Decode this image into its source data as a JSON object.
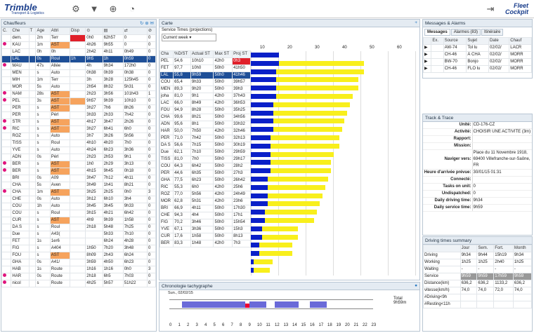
{
  "app": {
    "logo": "Trimble",
    "logo_sub": "Transport & Logistics",
    "fleet1": "Fleet",
    "fleet2": "Cockpit"
  },
  "drivers": {
    "title": "Chauffeurs",
    "cols": [
      "C.",
      "Che",
      "T",
      "Age",
      "Attri",
      "Disp",
      "⊙",
      "▤",
      "⇄",
      "⊘"
    ],
    "rows": [
      [
        "",
        "dem.",
        "",
        "2m",
        "Terr",
        "",
        "0h0",
        "62h57",
        "0",
        "0"
      ],
      [
        "•",
        "KAU",
        "",
        "1m",
        "AST",
        "",
        "4h26",
        "9h55",
        "0",
        "0"
      ],
      [
        "",
        "LAC",
        "",
        "0h",
        "0h",
        "",
        "2h42",
        "4h11",
        "0h49",
        "0"
      ],
      [
        "",
        "LAL",
        "",
        "0s",
        "Roul",
        "1h",
        "9h5",
        "1h",
        "0h59",
        "0"
      ],
      [
        "•",
        "MAU",
        "",
        "47s",
        "Allée",
        "",
        "4h",
        "9h34",
        "172h0",
        "0"
      ],
      [
        "",
        "MEN",
        "",
        "s",
        "Auto",
        "",
        "0h38",
        "0h39",
        "0h38",
        "0"
      ],
      [
        "",
        "MIH",
        "",
        "1m",
        "Terr",
        "",
        "3h",
        "3h28",
        "125h45",
        "0"
      ],
      [
        "",
        "MOR",
        "",
        "5s",
        "Auto",
        "",
        "2h54",
        "8h32",
        "5h31",
        "0"
      ],
      [
        "•",
        "NAM",
        "",
        "28s",
        "AST",
        "",
        "2h23",
        "3h56",
        "101h43",
        "1"
      ],
      [
        "•",
        "PEL",
        "",
        "3s",
        "AST",
        "",
        "9h57",
        "9h39",
        "10h10",
        "0"
      ],
      [
        "",
        "PER",
        "",
        "s",
        "AST",
        "",
        "3h27",
        "7h6",
        "8h26",
        "0"
      ],
      [
        "",
        "PER",
        "",
        "s",
        "Pérl",
        "",
        "3h33",
        "2h33",
        "7h42",
        "0"
      ],
      [
        "•",
        "STR",
        "",
        "s",
        "AST",
        "",
        "4h17",
        "3h47",
        "2h26",
        "0"
      ],
      [
        "•",
        "RIC",
        "",
        "s",
        "AST",
        "",
        "3h27",
        "6h41",
        "6h0",
        "0"
      ],
      [
        "",
        "ROZ",
        "",
        "s",
        "Auto",
        "",
        "3h7",
        "3h26",
        "5h56",
        "0"
      ],
      [
        "",
        "TISS",
        "",
        "s",
        "Roul",
        "",
        "4h10",
        "4h20",
        "7h0",
        "0"
      ],
      [
        "",
        "YVE",
        "",
        "s",
        "Auto",
        "",
        "4h24",
        "6h23",
        "3h36",
        "0"
      ],
      [
        "",
        "ADN",
        "",
        "0s",
        "Pérl",
        "",
        "2h23",
        "2h53",
        "9h1",
        "0"
      ],
      [
        "•",
        "BER",
        "",
        "s",
        "AST",
        "",
        "1h0",
        "2h29",
        "3h13",
        "0"
      ],
      [
        "•",
        "BER",
        "",
        "s",
        "AST",
        "",
        "4h15",
        "9h45",
        "0h18",
        "0"
      ],
      [
        "",
        "BRI",
        "",
        "0s",
        "A09",
        "",
        "3h47",
        "7h12",
        "4h11",
        "0"
      ],
      [
        "",
        "CHA",
        "",
        "5s",
        "Aven",
        "",
        "3h49",
        "1h41",
        "8h21",
        "0"
      ],
      [
        "•",
        "CHA",
        "",
        "1m",
        "AST",
        "",
        "3h25",
        "2h25",
        "0h0",
        "3"
      ],
      [
        "",
        "CHE",
        "",
        "0s",
        "Auto",
        "",
        "3h12",
        "6h10",
        "3h4",
        "0"
      ],
      [
        "",
        "COU",
        "",
        "1h",
        "Auto",
        "",
        "3h45",
        "3h45",
        "9h33",
        "0"
      ],
      [
        "",
        "COU",
        "",
        "s",
        "Roul",
        "",
        "3h15",
        "4h21",
        "6h42",
        "0"
      ],
      [
        "",
        "CUR",
        "",
        "s",
        "AST",
        "",
        "4h9",
        "9h39",
        "1h58",
        "0"
      ],
      [
        "",
        "DA S",
        "",
        "s",
        "Roul",
        "",
        "2h18",
        "5h48",
        "7h25",
        "0"
      ],
      [
        "",
        "Due",
        "",
        "s",
        "A43(",
        "",
        "",
        "5h33",
        "7h10",
        "0"
      ],
      [
        "",
        "FET",
        "",
        "1s",
        "1er6",
        "",
        "",
        "6h24",
        "4h28",
        "0"
      ],
      [
        "",
        "FIG",
        "",
        "s",
        "A404",
        "",
        "1h50",
        "7h20",
        "3h48",
        "0"
      ],
      [
        "",
        "FOU",
        "",
        "s",
        "AST",
        "",
        "8h09",
        "2h43",
        "6h24",
        "0"
      ],
      [
        "",
        "GHA",
        "",
        "0s",
        "A41/",
        "",
        "3h59",
        "4h50",
        "6h23",
        "0"
      ],
      [
        "",
        "HAB",
        "",
        "1s",
        "Route",
        "",
        "1h16",
        "1h16",
        "0h0",
        "3"
      ],
      [
        "•",
        "HAR",
        "",
        "0s",
        "Route",
        "",
        "2h18",
        "6h5",
        "7h03",
        "0"
      ],
      [
        "•",
        "nicol",
        "",
        "s",
        "Route",
        "",
        "4h25",
        "5h57",
        "51h22",
        "0"
      ]
    ]
  },
  "service": {
    "title": "Carte",
    "sub": "Service Times (projections)",
    "filter": "Current week",
    "cols": [
      "Cha",
      "%D/ST",
      "Actual ST",
      "Max ST",
      "Proj ST"
    ],
    "axis": [
      "10",
      "20",
      "30",
      "40",
      "50",
      "60"
    ],
    "rows": [
      [
        "PEL",
        "54,6",
        "10h10",
        "42h0",
        "0h3",
        22,
        6
      ],
      [
        "FET",
        "97,7",
        "10h0",
        "50h0",
        "41h50",
        22,
        0
      ],
      [
        "LAL",
        "55,8",
        "9h59",
        "50h0",
        "41h46",
        22,
        0
      ],
      [
        "COU",
        "65,4",
        "9h33",
        "50h0",
        "39h57",
        20,
        0
      ],
      [
        "MEN",
        "89,3",
        "9h20",
        "50h0",
        "39h3",
        18,
        0
      ],
      [
        "joha",
        "81,0",
        "9h1",
        "42h0",
        "37h43",
        17,
        0
      ],
      [
        "LAC",
        "66,0",
        "8h49",
        "42h0",
        "36h53",
        16,
        0
      ],
      [
        "FOU",
        "94,9",
        "8h28",
        "50h0",
        "35h25",
        14,
        0
      ],
      [
        "CHA",
        "99,6",
        "8h21",
        "50h0",
        "34h56",
        13,
        0
      ],
      [
        "ADN",
        "95,6",
        "8h1",
        "50h0",
        "33h32",
        12,
        0
      ],
      [
        "HAR",
        "50,0",
        "7h50",
        "42h0",
        "32h46",
        11,
        0
      ],
      [
        "PER",
        "71,0",
        "7h42",
        "50h0",
        "32h13",
        10,
        0
      ],
      [
        "DA S",
        "56,6",
        "7h15",
        "50h0",
        "30h19",
        9,
        0
      ],
      [
        "Due",
        "62,1",
        "7h10",
        "50h0",
        "29h59",
        8,
        0
      ],
      [
        "TISS",
        "81,0",
        "7h0",
        "50h0",
        "29h17",
        7,
        0
      ],
      [
        "COU",
        "64,3",
        "6h42",
        "50h0",
        "28h2",
        6,
        0
      ],
      [
        "PER",
        "44,6",
        "6h35",
        "50h0",
        "27h3",
        5,
        0
      ],
      [
        "GHA",
        "77,5",
        "6h23",
        "50h0",
        "26h42",
        4,
        0
      ],
      [
        "RIC",
        "55,3",
        "6h0",
        "42h0",
        "25h6",
        3,
        0
      ],
      [
        "ROZ",
        "77,0",
        "5h56",
        "42h0",
        "24h49",
        3,
        0
      ],
      [
        "MOR",
        "62,8",
        "5h31",
        "42h0",
        "23h6",
        3,
        0
      ],
      [
        "BRI",
        "66,9",
        "4h11",
        "50h0",
        "17h30",
        2,
        0
      ],
      [
        "CHE",
        "94,3",
        "4h4",
        "50h0",
        "17h1",
        2,
        0
      ],
      [
        "FIG",
        "70,2",
        "3h46",
        "50h0",
        "15h54",
        1,
        0
      ],
      [
        "YVE",
        "67,1",
        "3h36",
        "50h0",
        "15h3",
        1,
        0
      ],
      [
        "CUR",
        "17,6",
        "1h58",
        "50h0",
        "8h13",
        0,
        0
      ],
      [
        "BER",
        "83,3",
        "1h48",
        "42h0",
        "7h3",
        0,
        0
      ]
    ]
  },
  "chrono": {
    "title": "Chronologie tachygraphe",
    "date": "Sun., 02/02/15",
    "total_label": "Total",
    "total": "9h59m",
    "hours": [
      "0",
      "1",
      "2",
      "3",
      "4",
      "5",
      "6",
      "7",
      "8",
      "9",
      "10",
      "11",
      "12",
      "13",
      "14",
      "15",
      "16",
      "17",
      "18",
      "19",
      "20",
      "21",
      "22",
      "23"
    ]
  },
  "messages": {
    "title": "Messages & Alarms",
    "tabs": [
      "Messages",
      "Alarmes (83)",
      "Itinéraire"
    ],
    "cols": [
      "",
      "Ex.",
      "Source",
      "Sujet",
      "Date",
      "Chauf"
    ],
    "rows": [
      [
        "▶",
        "",
        "AW-74",
        "Tol lu",
        "02/02/",
        "LACR"
      ],
      [
        "▶",
        "",
        "CH-46",
        "À CHA",
        "02/02/",
        "MORR"
      ],
      [
        "▶",
        "",
        "BW-70",
        "Bonjo",
        "02/02/",
        "MORR"
      ],
      [
        "▶",
        "",
        "CH-46",
        "FLO lu",
        "02/02/",
        "MORR"
      ]
    ]
  },
  "track": {
    "title": "Track & Trace",
    "rows": [
      [
        "Unité:",
        "CD-176-CZ"
      ],
      [
        "Activité:",
        "CHOISIR UNE ACTIVITE (3m)"
      ],
      [
        "Rapport:",
        ""
      ],
      [
        "Mission:",
        ""
      ],
      [
        "Naviger vers:",
        "Place du 11 Novembre 1918, 69400 Villefranche-sur-Saône, FR"
      ],
      [
        "Heure d'arrivée prévue:",
        "30/01/15 01:31"
      ],
      [
        "Connecté:",
        ""
      ],
      [
        "Tasks on unit:",
        "0"
      ],
      [
        "Undispatched:",
        "0"
      ],
      [
        "Daily driving time:",
        "9h34"
      ],
      [
        "Daily service time:",
        "9h59"
      ]
    ]
  },
  "summary": {
    "title": "Driving times summary",
    "cols": [
      "",
      "Jour",
      "Sem.",
      "Fort.",
      "Month"
    ],
    "rows": [
      [
        "Driving",
        "9h34",
        "9h44",
        "15h19",
        "9h34"
      ],
      [
        "Working",
        "1h25",
        "1h25",
        "2h40",
        "1h25"
      ],
      [
        "Waiting",
        "-",
        "-",
        "-",
        "-"
      ],
      [
        "Service",
        "9h59",
        "9h59",
        "17h59",
        "9h59"
      ],
      [
        "Distance(km)",
        "636,2",
        "636,2",
        "1133,2",
        "636,2"
      ],
      [
        "vitesse(km/h)",
        "74,0",
        "74,0",
        "72,0",
        "74,0"
      ],
      [
        "#Driving<9h",
        "",
        "",
        "",
        ""
      ],
      [
        "#Resting<11h",
        "",
        "",
        "",
        ""
      ]
    ]
  }
}
